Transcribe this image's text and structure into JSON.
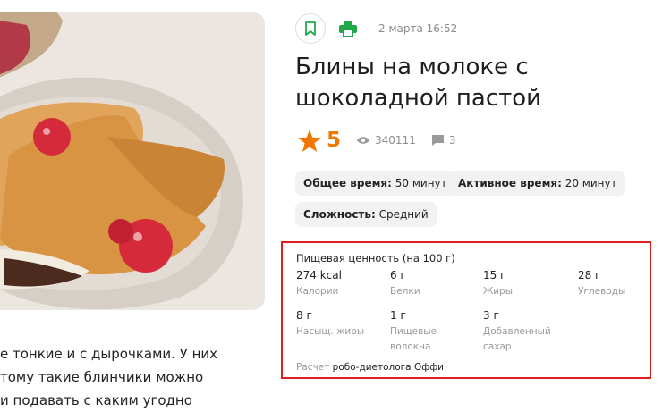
{
  "header": {
    "date": "2 марта 16:52"
  },
  "recipe": {
    "title": "Блины на молоке с шоколадной пастой",
    "rating": "5",
    "views": "340111",
    "comments": "3"
  },
  "times": {
    "total_label": "Общее время:",
    "total_value": " 50 минут",
    "active_label": "Активное время:",
    "active_value": " 20 минут",
    "difficulty_label": "Сложность:",
    "difficulty_value": " Средний"
  },
  "nutrition": {
    "heading": "Пищевая ценность (на 100 г)",
    "items": [
      {
        "value": "274 kcal",
        "label": "Калории"
      },
      {
        "value": "6 г",
        "label": "Белки"
      },
      {
        "value": "15 г",
        "label": "Жиры"
      },
      {
        "value": "28 г",
        "label": "Углеводы"
      },
      {
        "value": "8 г",
        "label": "Насыщ. жиры"
      },
      {
        "value": "1 г",
        "label_line1": "Пищевые",
        "label_line2": "волокна"
      },
      {
        "value": "3 г",
        "label_line1": "Добавленный",
        "label_line2": "сахар"
      }
    ],
    "calc_prefix": "Расчет",
    "calc_name": "робо-диетолога Оффи"
  },
  "intro": {
    "line1": "е тонкие и с дырочками. У них",
    "line2": "тому такие блинчики можно",
    "line3": "и подавать с каким угодно"
  },
  "colors": {
    "accent_green": "#1fa94b",
    "rating_orange": "#f07800",
    "highlight_red": "#e01e1e"
  },
  "icons": {
    "bookmark": "bookmark-icon",
    "print": "printer-icon",
    "star": "star-icon",
    "views": "eye-icon",
    "comments": "comment-icon"
  }
}
